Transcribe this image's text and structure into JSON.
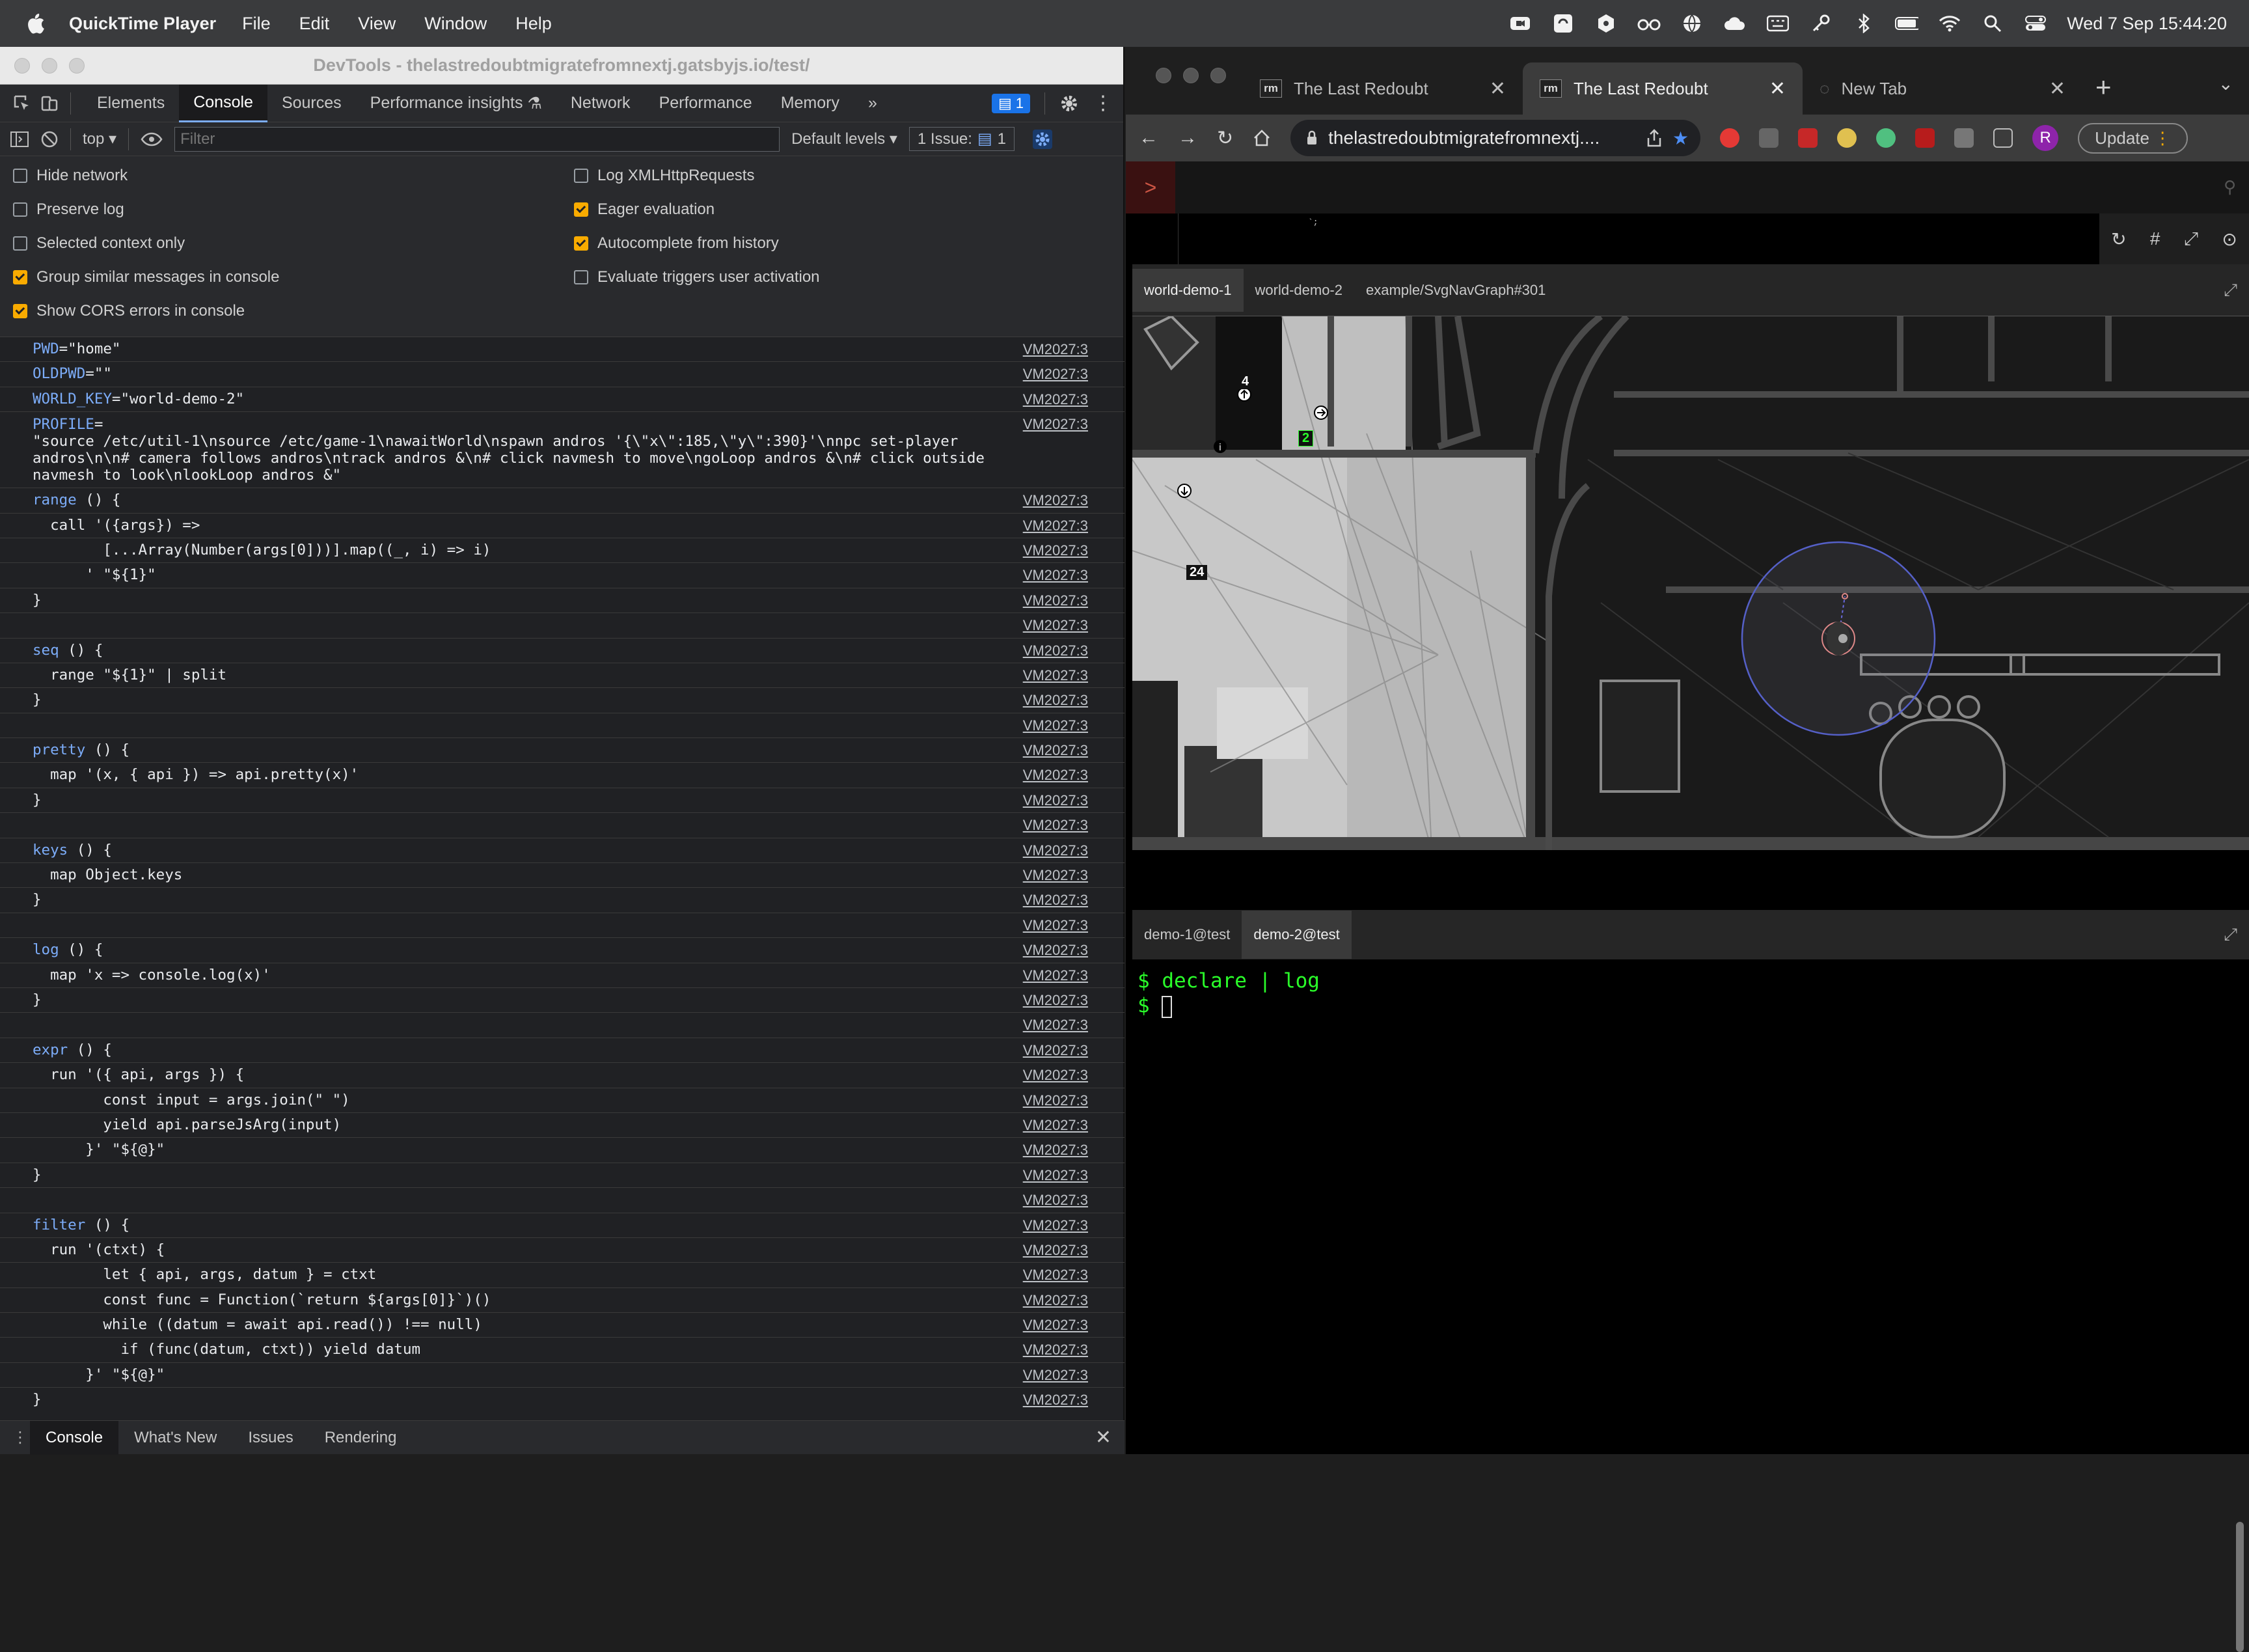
{
  "menubar": {
    "app_name": "QuickTime Player",
    "items": [
      "File",
      "Edit",
      "View",
      "Window",
      "Help"
    ],
    "datetime": "Wed 7 Sep  15:44:20"
  },
  "devtools": {
    "title": "DevTools - thelastredoubtmigratefromnextj.gatsbyjs.io/test/",
    "tabs": [
      "Elements",
      "Console",
      "Sources",
      "Performance insights",
      "Network",
      "Performance",
      "Memory"
    ],
    "active_tab": "Console",
    "messages_badge": "1",
    "context": "top",
    "filter_placeholder": "Filter",
    "levels": "Default levels",
    "issue_label": "1 Issue:",
    "issue_count": "1",
    "settings_left": [
      {
        "label": "Hide network",
        "checked": false
      },
      {
        "label": "Preserve log",
        "checked": false
      },
      {
        "label": "Selected context only",
        "checked": false
      },
      {
        "label": "Group similar messages in console",
        "checked": true
      },
      {
        "label": "Show CORS errors in console",
        "checked": true
      }
    ],
    "settings_right": [
      {
        "label": "Log XMLHttpRequests",
        "checked": false
      },
      {
        "label": "Eager evaluation",
        "checked": true
      },
      {
        "label": "Autocomplete from history",
        "checked": true
      },
      {
        "label": "Evaluate triggers user activation",
        "checked": false
      }
    ],
    "source_label": "VM2027:3",
    "console_lines": [
      {
        "v": "PWD",
        "t": "=\"home\""
      },
      {
        "v": "OLDPWD",
        "t": "=\"\""
      },
      {
        "v": "WORLD_KEY",
        "t": "=\"world-demo-2\""
      },
      {
        "v": "PROFILE",
        "t": "=\n\"source /etc/util-1\\nsource /etc/game-1\\nawaitWorld\\nspawn andros '{\\\"x\\\":185,\\\"y\\\":390}'\\nnpc set-player andros\\n\\n# camera follows andros\\ntrack andros &\\n# click navmesh to move\\ngoLoop andros &\\n# click outside navmesh to look\\nlookLoop andros &\"",
        "multi": true
      },
      {
        "v": "range",
        "t": " () {"
      },
      {
        "t": "  call '({args}) =>"
      },
      {
        "t": "        [...Array(Number(args[0]))].map((_, i) => i)"
      },
      {
        "t": "      ' \"${1}\""
      },
      {
        "t": "}"
      },
      {
        "t": ""
      },
      {
        "v": "seq",
        "t": " () {"
      },
      {
        "t": "  range \"${1}\" | split"
      },
      {
        "t": "}"
      },
      {
        "t": ""
      },
      {
        "v": "pretty",
        "t": " () {"
      },
      {
        "t": "  map '(x, { api }) => api.pretty(x)'"
      },
      {
        "t": "}"
      },
      {
        "t": ""
      },
      {
        "v": "keys",
        "t": " () {"
      },
      {
        "t": "  map Object.keys"
      },
      {
        "t": "}"
      },
      {
        "t": ""
      },
      {
        "v": "log",
        "t": " () {"
      },
      {
        "t": "  map 'x => console.log(x)'"
      },
      {
        "t": "}"
      },
      {
        "t": ""
      },
      {
        "v": "expr",
        "t": " () {"
      },
      {
        "t": "  run '({ api, args }) {"
      },
      {
        "t": "        const input = args.join(\" \")"
      },
      {
        "t": "        yield api.parseJsArg(input)"
      },
      {
        "t": "      }' \"${@}\""
      },
      {
        "t": "}"
      },
      {
        "t": ""
      },
      {
        "v": "filter",
        "t": " () {"
      },
      {
        "t": "  run '(ctxt) {"
      },
      {
        "t": "        let { api, args, datum } = ctxt"
      },
      {
        "t": "        const func = Function(`return ${args[0]}`)()"
      },
      {
        "t": "        while ((datum = await api.read()) !== null)"
      },
      {
        "t": "          if (func(datum, ctxt)) yield datum"
      },
      {
        "t": "      }' \"${@}\""
      },
      {
        "t": "}"
      },
      {
        "t": ""
      }
    ],
    "drawer_tabs": [
      "Console",
      "What's New",
      "Issues",
      "Rendering"
    ]
  },
  "chrome": {
    "tabs": [
      {
        "title": "The Last Redoubt",
        "favicon": "rm"
      },
      {
        "title": "The Last Redoubt",
        "favicon": "rm",
        "active": true
      },
      {
        "title": "New Tab",
        "favicon": ""
      }
    ],
    "url": "thelastredoubtmigratefromnextj....",
    "profile_initial": "R",
    "update_label": "Update",
    "world_tabs": [
      "world-demo-1",
      "world-demo-2",
      "example/SvgNavGraph#301"
    ],
    "active_world_tab": "world-demo-1",
    "map_labels": [
      "4",
      "2",
      "24"
    ],
    "terminal_tabs": [
      "demo-1@test",
      "demo-2@test"
    ],
    "active_terminal_tab": "demo-2@test",
    "terminal_lines": [
      "$ declare | log",
      "$ "
    ]
  },
  "colors": {
    "accent": "#1a73e8",
    "checkbox_on": "#f9ab00",
    "terminal_text": "#2aff2a"
  }
}
